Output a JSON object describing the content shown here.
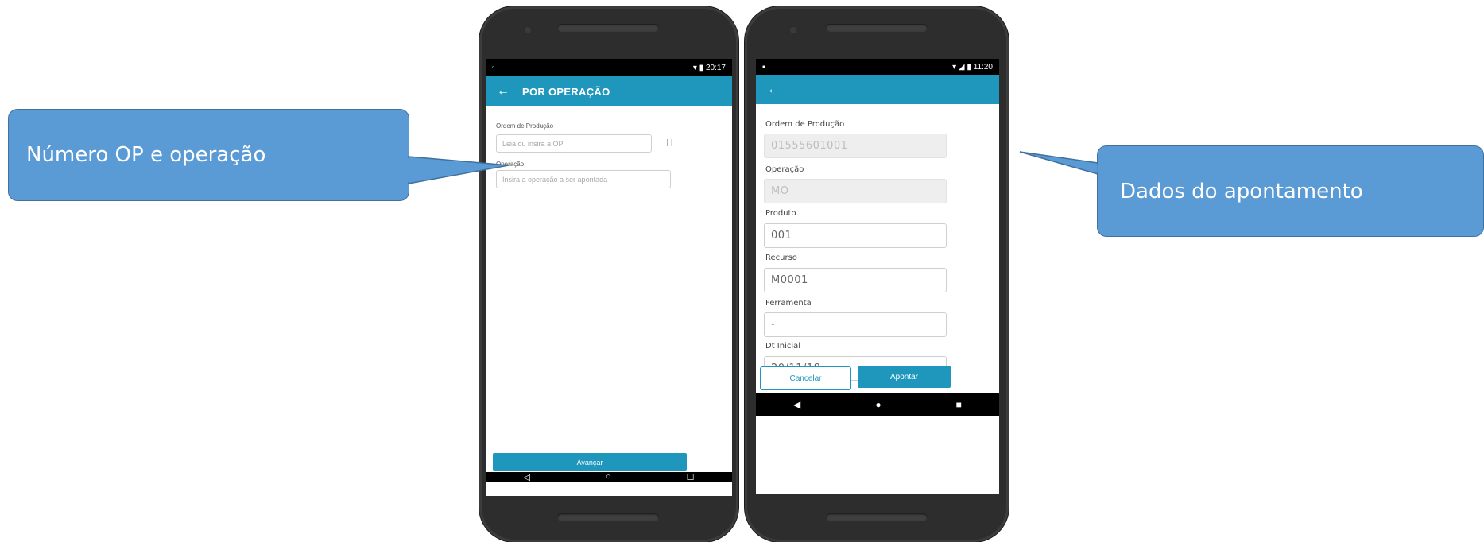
{
  "callouts": {
    "left": "Número OP e operação",
    "right": "Dados do apontamento"
  },
  "left_phone": {
    "status": {
      "time": "20:17"
    },
    "appbar": {
      "back_icon": "arrow-left-icon",
      "title": "POR OPERAÇÃO"
    },
    "fields": [
      {
        "label": "Ordem de Produção",
        "placeholder": "Leia ou insira a OP"
      },
      {
        "label": "Operação",
        "placeholder": "Insira a operação a ser apontada"
      }
    ],
    "advance_button": "Avançar",
    "navbar": {
      "back": "◁",
      "home": "○",
      "recents": "☐"
    }
  },
  "right_phone": {
    "status": {
      "time": "11:20"
    },
    "appbar": {
      "back_icon": "arrow-left-icon",
      "title": ""
    },
    "fields": [
      {
        "label": "Ordem de Produção",
        "value": "01555601001",
        "readonly": true
      },
      {
        "label": "Operação",
        "value": "MO",
        "readonly": true
      },
      {
        "label": "Produto",
        "value": "001",
        "readonly": false
      },
      {
        "label": "Recurso",
        "value": "M0001",
        "readonly": false
      },
      {
        "label": "Ferramenta",
        "value": "-",
        "readonly": false
      },
      {
        "label": "Dt Inicial",
        "value": "20/11/18",
        "readonly": false
      }
    ],
    "cancel_button": "Cancelar",
    "submit_button": "Apontar",
    "navbar": {
      "back": "◀",
      "home": "●",
      "recents": "■"
    }
  },
  "colors": {
    "accent": "#1f97bd",
    "callout": "#5b9bd5",
    "callout_border": "#41719c",
    "phone_body": "#2d2d2d"
  }
}
